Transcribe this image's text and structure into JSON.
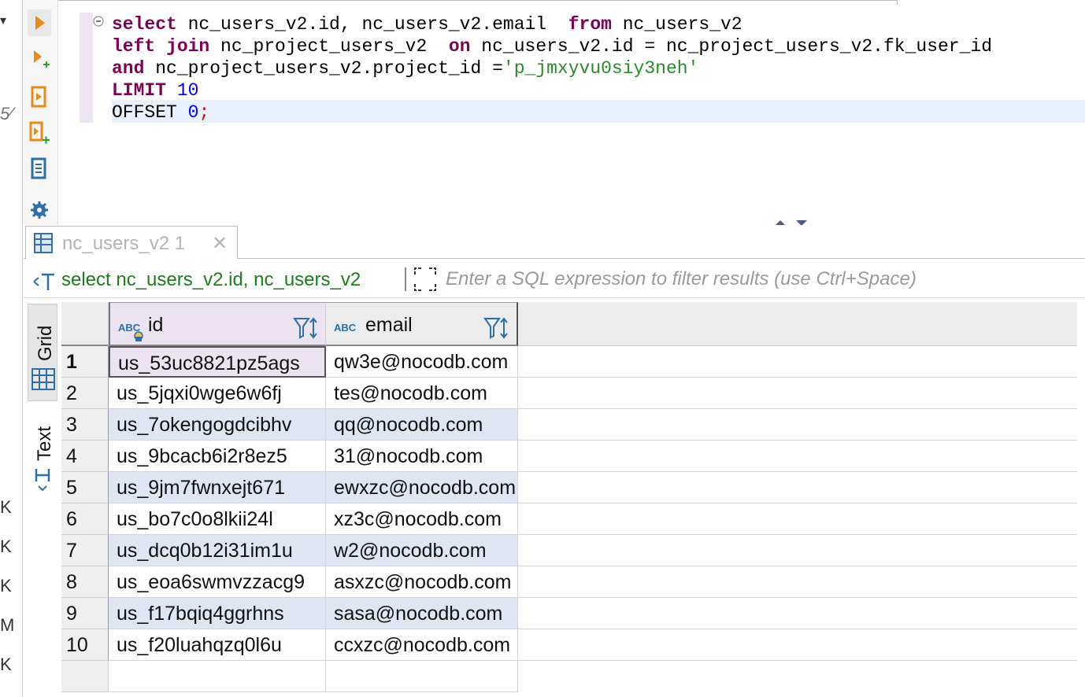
{
  "left_strip": {
    "fragments": [
      "▾",
      "5⁄",
      "K",
      "K",
      "K",
      "M",
      "K"
    ]
  },
  "editor": {
    "lines": [
      [
        {
          "t": "select",
          "c": "kw"
        },
        {
          "t": " nc_users_v2.id, nc_users_v2.email  "
        },
        {
          "t": "from",
          "c": "kw"
        },
        {
          "t": " nc_users_v2"
        }
      ],
      [
        {
          "t": "left join",
          "c": "kw"
        },
        {
          "t": " nc_project_users_v2  "
        },
        {
          "t": "on",
          "c": "kw"
        },
        {
          "t": " nc_users_v2.id = nc_project_users_v2.fk_user_id"
        }
      ],
      [
        {
          "t": "and",
          "c": "kw"
        },
        {
          "t": " nc_project_users_v2.project_id ="
        },
        {
          "t": "'p_jmxyvu0siy3neh'",
          "c": "str"
        }
      ],
      [
        {
          "t": "LIMIT",
          "c": "kw"
        },
        {
          "t": " "
        },
        {
          "t": "10",
          "c": "num"
        }
      ],
      [
        {
          "t": "OFFSET "
        },
        {
          "t": "0",
          "c": "num"
        },
        {
          "t": ";",
          "c": "semi"
        }
      ]
    ]
  },
  "results_tab": {
    "label": "nc_users_v2 1",
    "close": "✕"
  },
  "filter_bar": {
    "query_text": "select nc_users_v2.id, nc_users_v2",
    "placeholder": "Enter a SQL expression to filter results (use Ctrl+Space)"
  },
  "view_tabs": {
    "grid": "Grid",
    "text": "Text"
  },
  "grid": {
    "columns": [
      {
        "type_badge": "ABC",
        "name": "id"
      },
      {
        "type_badge": "ABC",
        "name": "email"
      }
    ],
    "rows": [
      {
        "n": "1",
        "id": "us_53uc8821pz5ags",
        "email": "qw3e@nocodb.com"
      },
      {
        "n": "2",
        "id": "us_5jqxi0wge6w6fj",
        "email": "tes@nocodb.com"
      },
      {
        "n": "3",
        "id": "us_7okengogdcibhv",
        "email": "qq@nocodb.com"
      },
      {
        "n": "4",
        "id": "us_9bcacb6i2r8ez5",
        "email": "31@nocodb.com"
      },
      {
        "n": "5",
        "id": "us_9jm7fwnxejt671",
        "email": "ewxzc@nocodb.com"
      },
      {
        "n": "6",
        "id": "us_bo7c0o8lkii24l",
        "email": "xz3c@nocodb.com"
      },
      {
        "n": "7",
        "id": "us_dcq0b12i31im1u",
        "email": "w2@nocodb.com"
      },
      {
        "n": "8",
        "id": "us_eoa6swmvzzacg9",
        "email": "asxzc@nocodb.com"
      },
      {
        "n": "9",
        "id": "us_f17bqiq4ggrhns",
        "email": "sasa@nocodb.com"
      },
      {
        "n": "10",
        "id": "us_f20luahqzq0l6u",
        "email": "ccxzc@nocodb.com"
      }
    ]
  },
  "colors": {
    "keyword": "#7f0055",
    "string": "#2a8a2a",
    "number": "#0000ff",
    "query_green": "#1a7f1a",
    "icon_orange": "#e8891a",
    "icon_blue": "#2f6ea8",
    "row_alt": "#dfe6f1"
  }
}
